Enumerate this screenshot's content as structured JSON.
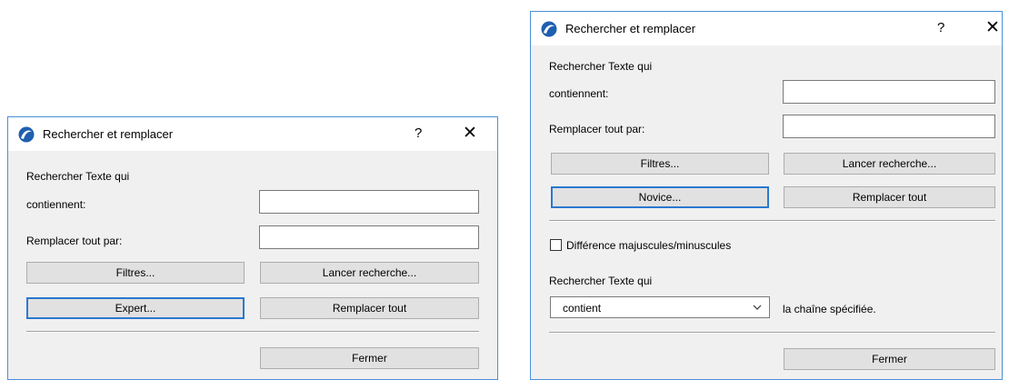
{
  "left": {
    "title": "Rechercher et remplacer",
    "help": "?",
    "close": "✕",
    "heading": "Rechercher Texte qui",
    "contains_label": "contiennent:",
    "contains_value": "",
    "replace_label": "Remplacer tout par:",
    "replace_value": "",
    "filters_button": "Filtres...",
    "search_button": "Lancer recherche...",
    "mode_button": "Expert...",
    "replace_all_button": "Remplacer tout",
    "close_button": "Fermer"
  },
  "right": {
    "title": "Rechercher et remplacer",
    "help": "?",
    "close": "✕",
    "heading": "Rechercher Texte qui",
    "contains_label": "contiennent:",
    "contains_value": "",
    "replace_label": "Remplacer tout par:",
    "replace_value": "",
    "filters_button": "Filtres...",
    "search_button": "Lancer recherche...",
    "mode_button": "Novice...",
    "replace_all_button": "Remplacer tout",
    "case_checkbox_label": "Différence majuscules/minuscules",
    "case_checked": false,
    "heading2": "Rechercher Texte qui",
    "condition_select": "contient",
    "condition_suffix": "la chaîne spécifiée.",
    "close_button": "Fermer"
  },
  "colors": {
    "accent": "#2b78cf",
    "dialog_bg": "#f0f0f0",
    "button_bg": "#e1e1e1"
  },
  "icons": {
    "app": "archicad-logo-icon",
    "chevron": "chevron-down-icon",
    "close": "close-icon"
  }
}
